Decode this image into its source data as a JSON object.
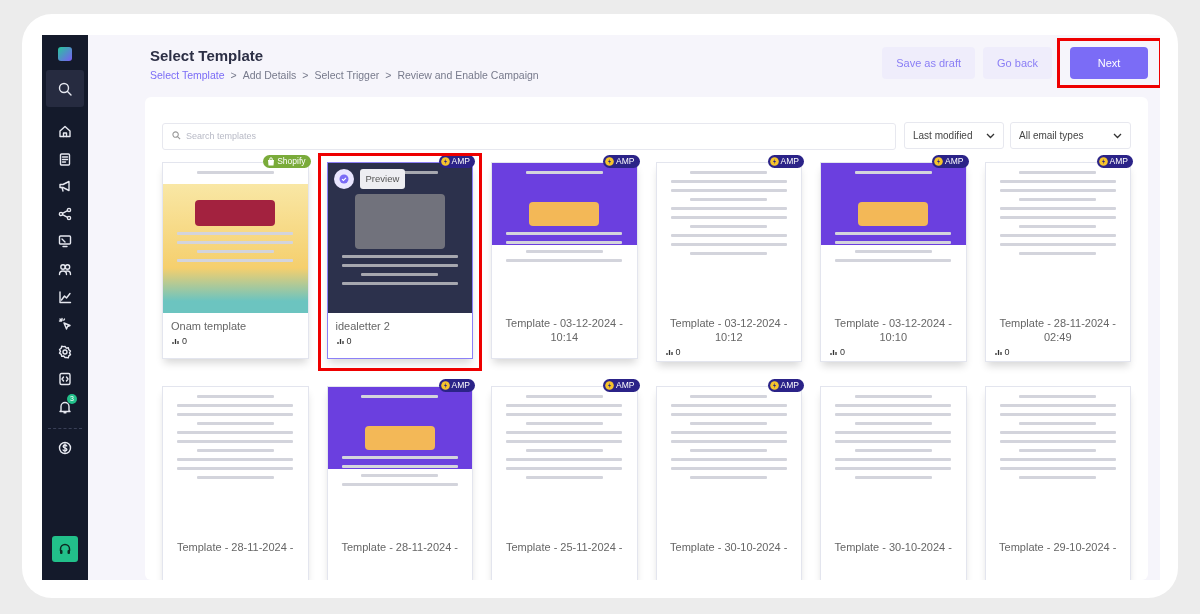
{
  "sidebar": {
    "items": [
      {
        "selected": true
      },
      {
        "selected": false
      },
      {
        "selected": false
      },
      {
        "selected": false
      },
      {
        "selected": false
      },
      {
        "selected": false
      },
      {
        "selected": false
      },
      {
        "selected": false
      },
      {
        "selected": false
      },
      {
        "selected": false
      },
      {
        "selected": false
      },
      {
        "selected": false,
        "badge": "3"
      },
      {
        "selected": false
      }
    ]
  },
  "header": {
    "title": "Select Template",
    "steps": [
      {
        "label": "Select Template",
        "selected": true
      },
      {
        "label": "Add Details",
        "selected": false
      },
      {
        "label": "Select Trigger",
        "selected": false
      },
      {
        "label": "Review and Enable Campaign",
        "selected": false
      }
    ],
    "separator": ">",
    "buttons": [
      {
        "label": "Save as draft",
        "kind": "light",
        "highlighted": false
      },
      {
        "label": "Go back",
        "kind": "light",
        "highlighted": false
      },
      {
        "label": "Next",
        "kind": "primary",
        "highlighted": true
      }
    ]
  },
  "search": {
    "placeholder": "Search templates"
  },
  "filters": [
    {
      "value": "Last modified"
    },
    {
      "value": "All email types"
    }
  ],
  "templates": [
    {
      "caption": "Onam template",
      "kind": "festive",
      "badge": {
        "kind": "shopify",
        "label": "Shopify"
      },
      "stats": "0",
      "selected": false,
      "highlighted": false
    },
    {
      "caption": "idealetter 2",
      "kind": "dark",
      "badge": {
        "kind": "amp",
        "label": "AMP"
      },
      "stats": "0",
      "selected": true,
      "preview_label": "Preview",
      "highlighted": true
    },
    {
      "caption": "Template - 03-12-2024 - 10:14",
      "kind": "purple",
      "badge": {
        "kind": "amp",
        "label": "AMP"
      },
      "selected": false,
      "highlighted": false
    },
    {
      "caption": "Template - 03-12-2024 - 10:12",
      "kind": "document",
      "badge": {
        "kind": "amp",
        "label": "AMP"
      },
      "stats": "0",
      "selected": false,
      "highlighted": false
    },
    {
      "caption": "Template - 03-12-2024 - 10:10",
      "kind": "purple",
      "badge": {
        "kind": "amp",
        "label": "AMP"
      },
      "stats": "0",
      "selected": false,
      "highlighted": false
    },
    {
      "caption": "Template - 28-11-2024 - 02:49",
      "kind": "document",
      "badge": {
        "kind": "amp",
        "label": "AMP"
      },
      "stats": "0",
      "selected": false,
      "highlighted": false
    },
    {
      "caption": "Template - 28-11-2024 -",
      "kind": "document",
      "selected": false,
      "highlighted": false
    },
    {
      "caption": "Template - 28-11-2024 -",
      "kind": "purple",
      "badge": {
        "kind": "amp",
        "label": "AMP"
      },
      "selected": false,
      "highlighted": false
    },
    {
      "caption": "Template - 25-11-2024 -",
      "kind": "document",
      "badge": {
        "kind": "amp",
        "label": "AMP"
      },
      "selected": false,
      "highlighted": false
    },
    {
      "caption": "Template - 30-10-2024 -",
      "kind": "document",
      "badge": {
        "kind": "amp",
        "label": "AMP"
      },
      "selected": false,
      "highlighted": false
    },
    {
      "caption": "Template - 30-10-2024 -",
      "kind": "document",
      "selected": false,
      "highlighted": false
    },
    {
      "caption": "Template - 29-10-2024 -",
      "kind": "document",
      "selected": false,
      "highlighted": false
    }
  ]
}
